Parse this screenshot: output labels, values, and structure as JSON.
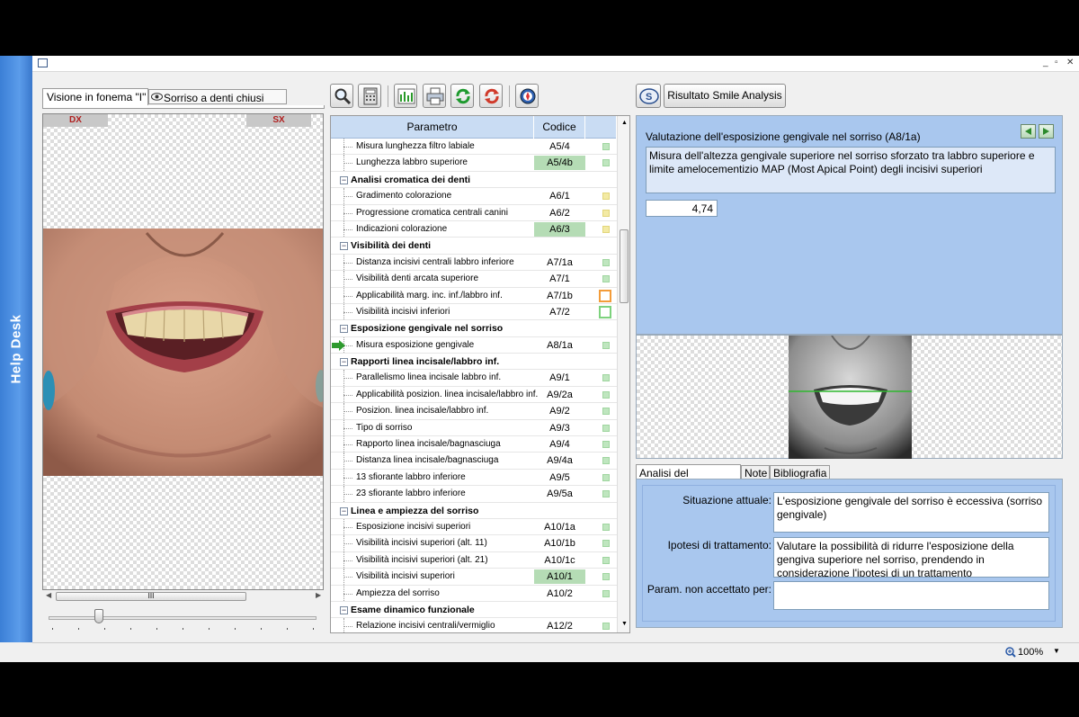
{
  "sidebar": {
    "label": "Help Desk"
  },
  "window": {
    "controls": [
      "_",
      "▫",
      "✕"
    ]
  },
  "left_tabs": [
    {
      "label": "Visione in fonema \"I\""
    },
    {
      "label": "Sorriso a denti chiusi"
    }
  ],
  "photo_labels": {
    "dx": "DX",
    "sx": "SX"
  },
  "scrollbar_grip": "III",
  "toolbar": {
    "icons": [
      "magnifier-icon",
      "calculator-icon",
      "chart-icon",
      "printer-icon",
      "refresh-green-icon",
      "refresh-red-icon",
      "compass-icon"
    ],
    "smile_button": "Risultato Smile Analysis"
  },
  "table": {
    "headers": {
      "parametro": "Parametro",
      "codice": "Codice"
    },
    "rows": [
      {
        "type": "item",
        "label": "Misura lunghezza filtro labiale",
        "code": "A5/4",
        "status": "g",
        "hl": false
      },
      {
        "type": "item",
        "label": "Lunghezza labbro superiore",
        "code": "A5/4b",
        "status": "g",
        "hl": true
      },
      {
        "type": "group",
        "label": "Analisi cromatica dei denti"
      },
      {
        "type": "item",
        "label": "Gradimento colorazione",
        "code": "A6/1",
        "status": "y",
        "hl": false
      },
      {
        "type": "item",
        "label": "Progressione cromatica centrali canini",
        "code": "A6/2",
        "status": "y",
        "hl": false
      },
      {
        "type": "item",
        "label": "Indicazioni colorazione",
        "code": "A6/3",
        "status": "y",
        "hl": true
      },
      {
        "type": "group",
        "label": "Visibilità dei denti"
      },
      {
        "type": "item",
        "label": "Distanza incisivi centrali labbro inferiore",
        "code": "A7/1a",
        "status": "g",
        "hl": false
      },
      {
        "type": "item",
        "label": "Visibilità denti arcata superiore",
        "code": "A7/1",
        "status": "g",
        "hl": false
      },
      {
        "type": "item",
        "label": "Applicabilità marg. inc. inf./labbro inf.",
        "code": "A7/1b",
        "status": "og",
        "hl": false
      },
      {
        "type": "item",
        "label": "Visibilità incisivi inferiori",
        "code": "A7/2",
        "status": "gg",
        "hl": false
      },
      {
        "type": "group",
        "label": "Esposizione gengivale nel sorriso"
      },
      {
        "type": "item",
        "label": "Misura esposizione gengivale",
        "code": "A8/1a",
        "status": "g",
        "hl": false,
        "current": true
      },
      {
        "type": "group",
        "label": "Rapporti linea incisale/labbro inf."
      },
      {
        "type": "item",
        "label": "Parallelismo linea incisale labbro inf.",
        "code": "A9/1",
        "status": "g",
        "hl": false
      },
      {
        "type": "item",
        "label": "Applicabilità posizion. linea incisale/labbro inf.",
        "code": "A9/2a",
        "status": "g",
        "hl": false
      },
      {
        "type": "item",
        "label": "Posizion. linea incisale/labbro inf.",
        "code": "A9/2",
        "status": "g",
        "hl": false
      },
      {
        "type": "item",
        "label": "Tipo di sorriso",
        "code": "A9/3",
        "status": "g",
        "hl": false
      },
      {
        "type": "item",
        "label": "Rapporto linea incisale/bagnasciuga",
        "code": "A9/4",
        "status": "g",
        "hl": false
      },
      {
        "type": "item",
        "label": "Distanza linea incisale/bagnasciuga",
        "code": "A9/4a",
        "status": "g",
        "hl": false
      },
      {
        "type": "item",
        "label": "13 sfiorante labbro inferiore",
        "code": "A9/5",
        "status": "g",
        "hl": false
      },
      {
        "type": "item",
        "label": "23 sfiorante labbro inferiore",
        "code": "A9/5a",
        "status": "g",
        "hl": false
      },
      {
        "type": "group",
        "label": "Linea e ampiezza del sorriso"
      },
      {
        "type": "item",
        "label": "Esposizione incisivi superiori",
        "code": "A10/1a",
        "status": "g",
        "hl": false
      },
      {
        "type": "item",
        "label": "Visibilità incisivi superiori (alt. 11)",
        "code": "A10/1b",
        "status": "g",
        "hl": false
      },
      {
        "type": "item",
        "label": "Visibilità incisivi superiori (alt. 21)",
        "code": "A10/1c",
        "status": "g",
        "hl": false
      },
      {
        "type": "item",
        "label": "Visibilità incisivi superiori",
        "code": "A10/1",
        "status": "g",
        "hl": true
      },
      {
        "type": "item",
        "label": "Ampiezza del sorriso",
        "code": "A10/2",
        "status": "g",
        "hl": false
      },
      {
        "type": "group",
        "label": "Esame dinamico funzionale"
      },
      {
        "type": "item",
        "label": "Relazione incisivi centrali/vermiglio",
        "code": "A12/2",
        "status": "g",
        "hl": false
      }
    ]
  },
  "detail": {
    "title": "Valutazione dell'esposizione gengivale nel sorriso (A8/1a)",
    "description": "Misura dell'altezza gengivale superiore nel sorriso sforzato tra labbro superiore e limite amelocementizio MAP (Most Apical Point) degli incisivi superiori",
    "value": "4,74"
  },
  "bottom_tabs": [
    "Analisi del parametro",
    "Note",
    "Bibliografia"
  ],
  "analysis": {
    "situazione_label": "Situazione attuale:",
    "situazione_value": "L'esposizione gengivale del sorriso è eccessiva (sorriso gengivale)",
    "ipotesi_label": "Ipotesi di trattamento:",
    "ipotesi_value": "Valutare la possibilità di ridurre l'esposizione della gengiva superiore nel sorriso, prendendo in considerazione l'ipotesi di un trattamento mucogengivale, ortodontico o, se indicat...",
    "param_label": "Param. non accettato per:",
    "param_value": ""
  },
  "status": {
    "zoom": "100%"
  }
}
